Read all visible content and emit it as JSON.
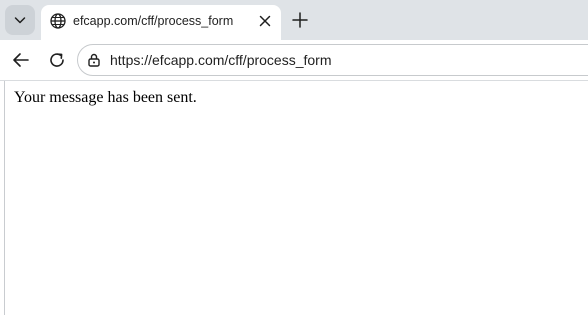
{
  "browser": {
    "tab": {
      "title": "efcapp.com/cff/process_form",
      "favicon_icon": "globe-icon",
      "close_icon": "close-icon"
    },
    "tab_search_icon": "chevron-down-icon",
    "new_tab_icon": "plus-icon",
    "toolbar": {
      "back_icon": "back-arrow-icon",
      "reload_icon": "reload-icon",
      "site_info_icon": "site-info-icon",
      "url": "https://efcapp.com/cff/process_form"
    }
  },
  "page": {
    "message": "Your message has been sent."
  },
  "colors": {
    "tabstrip_bg": "#dfe3e7",
    "active_tab_bg": "#ffffff",
    "text": "#1f1f1f"
  }
}
